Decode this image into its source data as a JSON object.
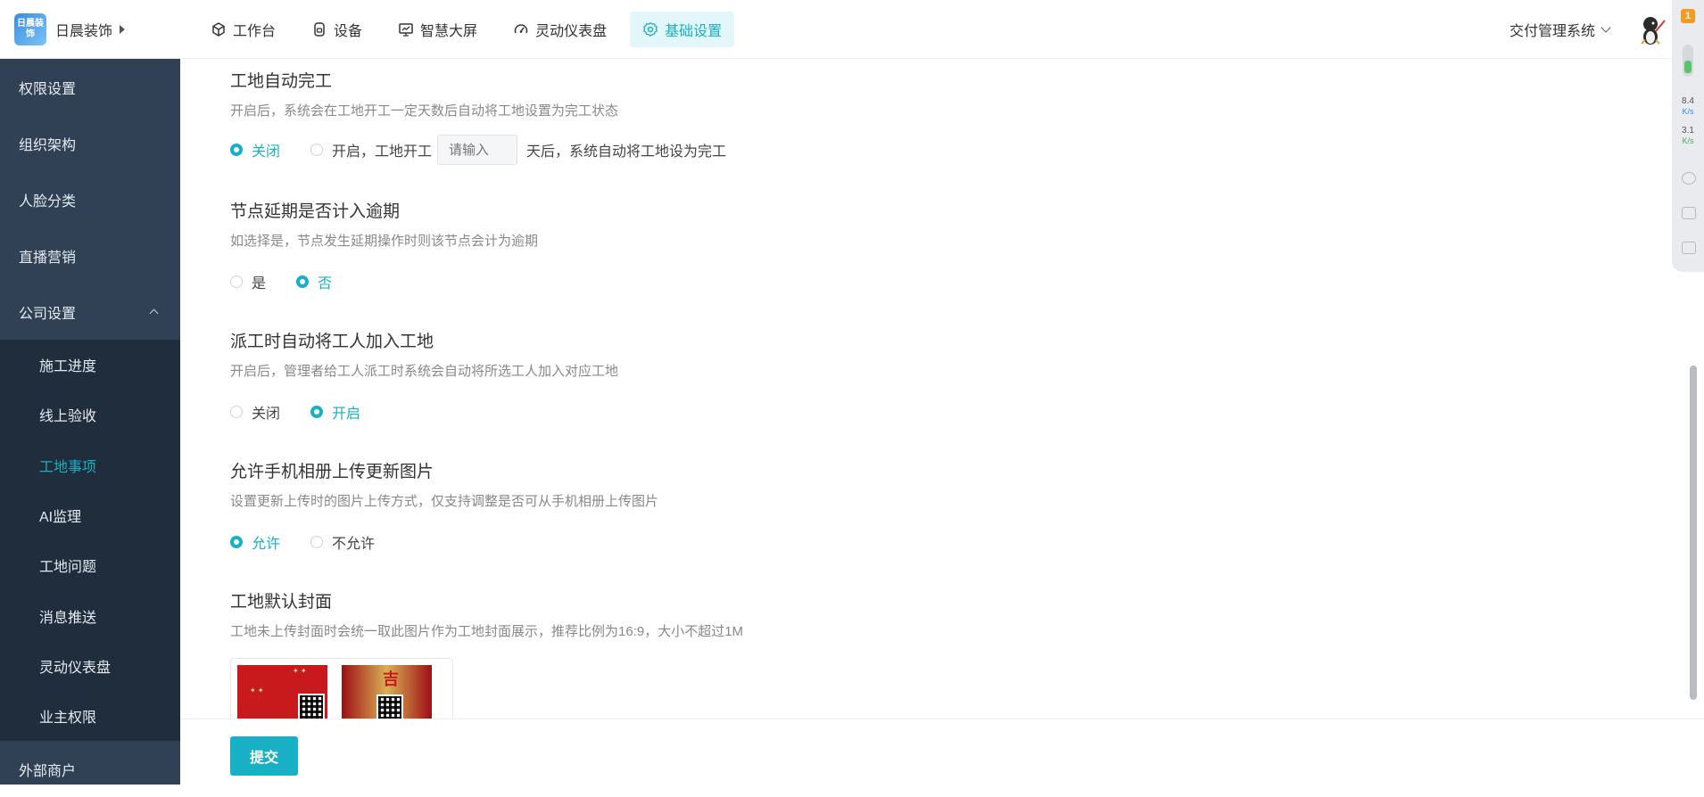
{
  "header": {
    "logo_text": "日晨装饰",
    "company_name": "日晨装饰",
    "nav": [
      {
        "label": "工作台",
        "icon": "cube-icon"
      },
      {
        "label": "设备",
        "icon": "device-icon"
      },
      {
        "label": "智慧大屏",
        "icon": "monitor-icon"
      },
      {
        "label": "灵动仪表盘",
        "icon": "gauge-icon"
      },
      {
        "label": "基础设置",
        "icon": "settings-icon",
        "active": true
      }
    ],
    "system_switch": "交付管理系统"
  },
  "float_toolbar": {
    "badge": "1",
    "upload_speed": "8.4",
    "upload_unit": "K/s",
    "download_speed": "3.1",
    "download_unit": "K/s"
  },
  "sidebar": {
    "items": [
      {
        "label": "权限设置"
      },
      {
        "label": "组织架构"
      },
      {
        "label": "人脸分类"
      },
      {
        "label": "直播营销"
      },
      {
        "label": "公司设置",
        "expanded": true
      }
    ],
    "sub_items": [
      {
        "label": "施工进度"
      },
      {
        "label": "线上验收"
      },
      {
        "label": "工地事项",
        "active": true
      },
      {
        "label": "AI监理"
      },
      {
        "label": "工地问题"
      },
      {
        "label": "消息推送"
      },
      {
        "label": "灵动仪表盘"
      },
      {
        "label": "业主权限"
      }
    ],
    "bottom_item": {
      "label": "外部商户"
    }
  },
  "settings": {
    "auto_complete": {
      "title": "工地自动完工",
      "desc": "开启后，系统会在工地开工一定天数后自动将工地设置为完工状态",
      "option_off": "关闭",
      "option_on_prefix": "开启，工地开工",
      "days_placeholder": "请输入",
      "option_on_suffix": "天后，系统自动将工地设为完工",
      "selected": "关闭"
    },
    "node_delay": {
      "title": "节点延期是否计入逾期",
      "desc": "如选择是，节点发生延期操作时则该节点会计为逾期",
      "option_yes": "是",
      "option_no": "否",
      "selected": "否"
    },
    "dispatch_join": {
      "title": "派工时自动将工人加入工地",
      "desc": "开启后，管理者给工人派工时系统会自动将所选工人加入对应工地",
      "option_off": "关闭",
      "option_on": "开启",
      "selected": "开启"
    },
    "album_upload": {
      "title": "允许手机相册上传更新图片",
      "desc": "设置更新上传时的图片上传方式，仅支持调整是否可从手机相册上传图片",
      "option_allow": "允许",
      "option_deny": "不允许",
      "selected": "允许"
    },
    "default_cover": {
      "title": "工地默认封面",
      "desc": "工地未上传封面时会统一取此图片作为工地封面展示，推荐比例为16:9，大小不超过1M",
      "cover2_char": "吉"
    }
  },
  "footer": {
    "submit_label": "提交"
  },
  "colors": {
    "accent": "#17b0c4",
    "sidebar_bg": "#304156",
    "sidebar_sub_bg": "#1f2d3d"
  }
}
